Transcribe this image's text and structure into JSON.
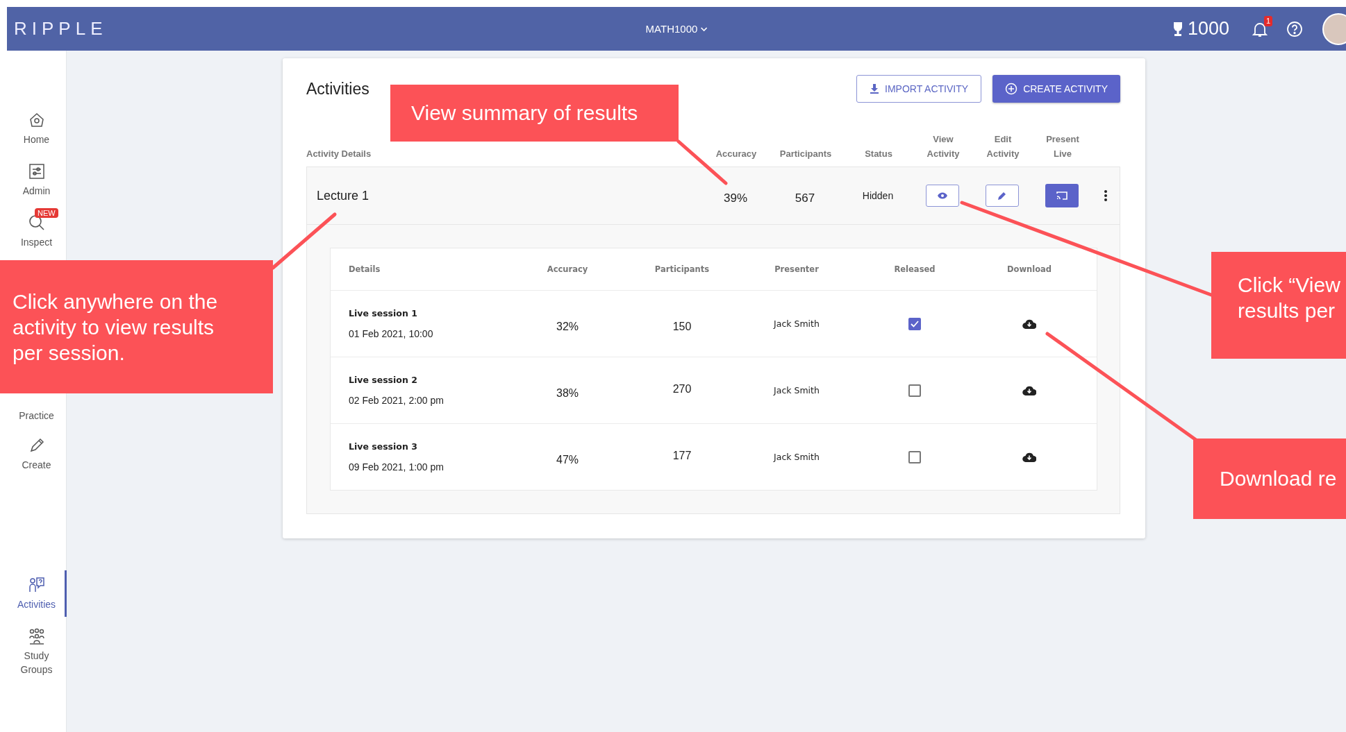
{
  "topbar": {
    "logo": "RIPPLE",
    "course": "MATH1000",
    "points": "1000",
    "notifications": "1"
  },
  "sidebar": {
    "items": [
      {
        "label": "Home",
        "kind": "home",
        "selected": false
      },
      {
        "label": "Admin",
        "kind": "admin",
        "selected": false
      },
      {
        "label": "Inspect",
        "kind": "inspect",
        "selected": false,
        "badge": "NEW"
      },
      {
        "label": "Practice",
        "kind": "practice",
        "selected": false
      },
      {
        "label": "Create",
        "kind": "create",
        "selected": false
      },
      {
        "label": "Activities",
        "kind": "activities",
        "selected": true
      },
      {
        "label": "Study Groups",
        "kind": "groups",
        "selected": false
      }
    ]
  },
  "card": {
    "title": "Activities",
    "buttons": [
      {
        "label": "IMPORT ACTIVITY",
        "kind": "import"
      },
      {
        "label": "CREATE ACTIVITY",
        "kind": "create"
      }
    ],
    "columns": [
      "Activity Details",
      "Accuracy",
      "Participants",
      "Status",
      "View Activity",
      "Edit Activity",
      "Present Live"
    ],
    "activity": {
      "name": "Lecture 1",
      "accuracy": "39%",
      "participants": "567",
      "status": "Hidden",
      "expanded": true,
      "session_columns": [
        "Details",
        "Accuracy",
        "Participants",
        "Presenter",
        "Released",
        "Download"
      ],
      "sessions": [
        {
          "name": "Live session 1",
          "date": "01 Feb 2021, 10:00",
          "accuracy": "32%",
          "participants": "150",
          "presenter": "Jack Smith",
          "released": true
        },
        {
          "name": "Live session 2",
          "date": "02 Feb 2021, 2:00 pm",
          "accuracy": "38%",
          "participants": "270",
          "presenter": "Jack Smith",
          "released": false
        },
        {
          "name": "Live session 3",
          "date": "09 Feb 2021, 1:00 pm",
          "accuracy": "47%",
          "participants": "177",
          "presenter": "Jack Smith",
          "released": false
        }
      ]
    }
  },
  "callouts": [
    {
      "lines": [
        "View summary of results"
      ]
    },
    {
      "lines": [
        "Click anywhere on the",
        "activity to view results",
        "per session."
      ]
    },
    {
      "lines": [
        "Click “View",
        "results per"
      ]
    },
    {
      "lines": [
        "Download re"
      ]
    }
  ]
}
